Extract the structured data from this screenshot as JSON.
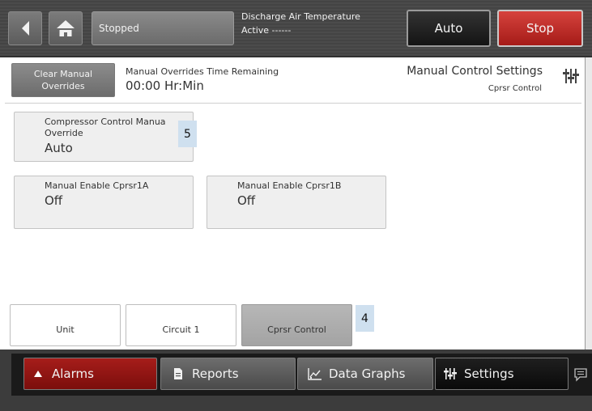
{
  "topbar": {
    "status": "Stopped",
    "point_name": "Discharge Air Temperature",
    "point_state": "Active ------",
    "auto_label": "Auto",
    "stop_label": "Stop"
  },
  "header": {
    "clear_overrides_line1": "Clear Manual",
    "clear_overrides_line2": "Overrides",
    "time_remaining_label": "Manual Overrides Time Remaining",
    "time_remaining_value": "00:00 Hr:Min",
    "title": "Manual Control Settings",
    "subtitle": "Cprsr Control"
  },
  "tiles": [
    {
      "label_line1": "Compressor Control Manua",
      "label_line2": "Override",
      "value": "Auto"
    },
    {
      "label_line1": "Manual Enable Cprsr1A",
      "value": "Off"
    },
    {
      "label_line1": "Manual Enable Cprsr1B",
      "value": "Off"
    }
  ],
  "tabs": [
    "Unit",
    "Circuit 1",
    "Cprsr Control"
  ],
  "badges": {
    "tile_marker": "5",
    "tab_marker": "4"
  },
  "nav": {
    "alarms": "Alarms",
    "reports": "Reports",
    "data_graphs": "Data Graphs",
    "settings": "Settings"
  },
  "colors": {
    "stop_red": "#a51b18",
    "alarm_red": "#8e1512",
    "selected_tab": "#adadad",
    "badge_bg": "#cfe0ef"
  },
  "icons": {
    "back": "back-arrow-icon",
    "home": "home-icon",
    "settings_sliders": "sliders-icon",
    "alarm": "alarm-bell-icon",
    "reports": "document-icon",
    "data_graphs": "chart-icon",
    "chat": "chat-bubble-icon"
  }
}
